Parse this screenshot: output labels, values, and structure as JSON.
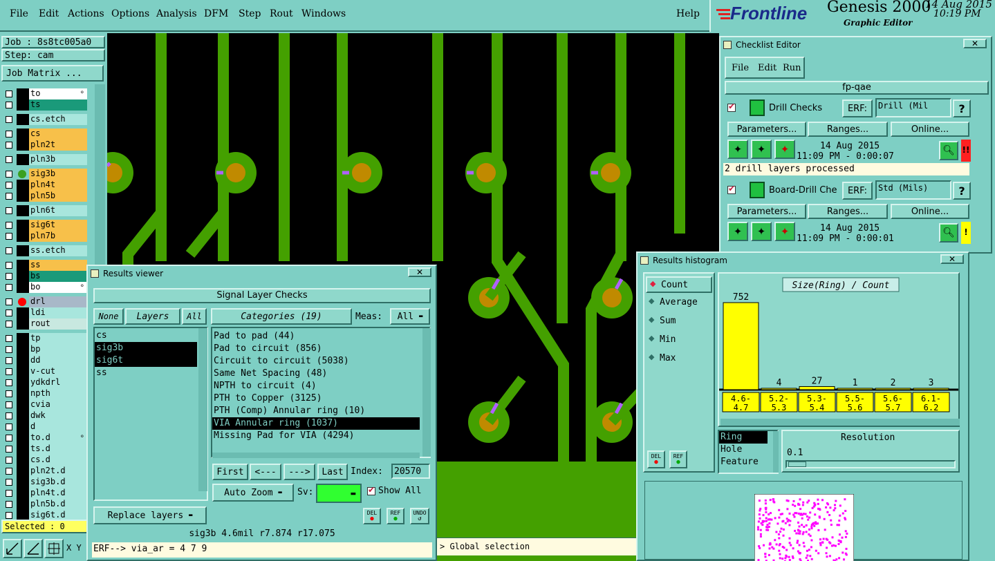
{
  "menubar": {
    "items": [
      "File",
      "Edit",
      "Actions",
      "Options",
      "Analysis",
      "DFM",
      "Step",
      "Rout",
      "Windows"
    ],
    "help": "Help"
  },
  "brand": {
    "logo": "Frontline",
    "product": "Genesis 2000",
    "subtitle": "Graphic Editor",
    "date": "14 Aug 2015",
    "time": "10:19 PM"
  },
  "left": {
    "job": "Job : 8s8tc005a0",
    "step": "Step: cam",
    "job_matrix": "Job Matrix ...",
    "selected": "Selected : 0",
    "layers": [
      {
        "name": "to",
        "color": "#ffffff",
        "flag": true
      },
      {
        "name": "ts",
        "color": "#1a9a7a"
      },
      {
        "name": "cs.etch",
        "color": "#a8e6dd"
      },
      {
        "name": "cs",
        "color": "#f7c04a"
      },
      {
        "name": "pln2t",
        "color": "#f7c04a"
      },
      {
        "name": "pln3b",
        "color": "#a8e6dd"
      },
      {
        "name": "sig3b",
        "color": "#f7c04a",
        "dot": "#3aa020"
      },
      {
        "name": "pln4t",
        "color": "#f7c04a"
      },
      {
        "name": "pln5b",
        "color": "#f7c04a"
      },
      {
        "name": "pln6t",
        "color": "#a8e6dd"
      },
      {
        "name": "sig6t",
        "color": "#f7c04a"
      },
      {
        "name": "pln7b",
        "color": "#f7c04a"
      },
      {
        "name": "ss.etch",
        "color": "#a8e6dd"
      },
      {
        "name": "ss",
        "color": "#f7c04a"
      },
      {
        "name": "bs",
        "color": "#1a9a7a"
      },
      {
        "name": "bo",
        "color": "#ffffff",
        "flag": true
      },
      {
        "name": "drl",
        "color": "#a8b8c8",
        "dot": "#ff0000"
      },
      {
        "name": "ldi",
        "color": "#a8e6dd"
      },
      {
        "name": "rout",
        "color": "#c8e8e0"
      },
      {
        "name": "tp",
        "color": "#a8e6dd"
      },
      {
        "name": "bp",
        "color": "#a8e6dd"
      },
      {
        "name": "dd",
        "color": "#a8e6dd"
      },
      {
        "name": "v-cut",
        "color": "#a8e6dd"
      },
      {
        "name": "ydkdrl",
        "color": "#a8e6dd"
      },
      {
        "name": "npth",
        "color": "#a8e6dd"
      },
      {
        "name": "cvia",
        "color": "#a8e6dd"
      },
      {
        "name": "dwk",
        "color": "#a8e6dd"
      },
      {
        "name": "d",
        "color": "#a8e6dd"
      },
      {
        "name": "to.d",
        "color": "#a8e6dd",
        "flag": true
      },
      {
        "name": "ts.d",
        "color": "#a8e6dd"
      },
      {
        "name": "cs.d",
        "color": "#a8e6dd"
      },
      {
        "name": "pln2t.d",
        "color": "#a8e6dd"
      },
      {
        "name": "sig3b.d",
        "color": "#a8e6dd"
      },
      {
        "name": "pln4t.d",
        "color": "#a8e6dd"
      },
      {
        "name": "pln5b.d",
        "color": "#a8e6dd"
      },
      {
        "name": "sig6t.d",
        "color": "#a8e6dd"
      }
    ],
    "xy": "X Y"
  },
  "status_line": {
    "text": "> Global selection"
  },
  "checklist": {
    "title": "Checklist Editor",
    "menu": [
      "File",
      "Edit",
      "Run"
    ],
    "name": "fp-qae",
    "checks": [
      {
        "label": "Drill Checks",
        "erf": "ERF:",
        "erf_value": "Drill (Mil",
        "params": "Parameters...",
        "ranges": "Ranges...",
        "online": "Online...",
        "date": "14 Aug 2015",
        "time": "11:09 PM - 0:00:07",
        "status": "2 drill layers processed",
        "flag": "!!",
        "flag_color": "#ff2020"
      },
      {
        "label": "Board-Drill Che",
        "erf": "ERF:",
        "erf_value": "Std (Mils)",
        "params": "Parameters...",
        "ranges": "Ranges...",
        "online": "Online...",
        "date": "14 Aug 2015",
        "time": "11:09 PM - 0:00:01",
        "flag": "!",
        "flag_color": "#ffff00"
      }
    ],
    "help": "?"
  },
  "results_viewer": {
    "title": "Results viewer",
    "header": "Signal Layer Checks",
    "none": "None",
    "layers_label": "Layers",
    "all": "All",
    "layers": [
      "cs",
      "sig3b",
      "sig6t",
      "ss"
    ],
    "categories_label": "Categories (19)",
    "meas_label": "Meas:",
    "meas_value": "All",
    "categories": [
      "Pad to pad (44)",
      "Pad to circuit (856)",
      "Circuit to circuit (5038)",
      "Same Net Spacing (48)",
      "NPTH to circuit (4)",
      "PTH to Copper (3125)",
      "PTH (Comp) Annular ring (10)",
      "VIA Annular ring (1037)",
      "Missing Pad for VIA (4294)"
    ],
    "first": "First",
    "prev": "<---",
    "next": "--->",
    "last": "Last",
    "index_label": "Index:",
    "index_value": "20570",
    "auto_zoom": "Auto Zoom",
    "sv": "Sv:",
    "show_all": "Show All",
    "replace_layers": "Replace layers",
    "del": "DEL",
    "ref": "REF",
    "undo": "UNDO",
    "status": "sig3b 4.6mil  r7.874  r17.075",
    "erf": "ERF--> via_ar = 4 7 9"
  },
  "histogram": {
    "title": "Results histogram",
    "options": [
      "Count",
      "Average",
      "Sum",
      "Min",
      "Max"
    ],
    "selected": "Count",
    "del": "DEL",
    "ref": "REF",
    "resolution_label": "Resolution",
    "resolution_value": "0.1",
    "fields": [
      "Ring",
      "Hole",
      "Feature"
    ],
    "chart_title": "Size(Ring) / Count"
  },
  "chart_data": {
    "type": "bar",
    "title": "Size(Ring) / Count",
    "categories": [
      "4.6-4.7",
      "5.2-5.3",
      "5.3-5.4",
      "5.5-5.6",
      "5.6-5.7",
      "6.1-6.2"
    ],
    "category_lines": [
      [
        "4.6-",
        "4.7"
      ],
      [
        "5.2-",
        "5.3"
      ],
      [
        "5.3-",
        "5.4"
      ],
      [
        "5.5-",
        "5.6"
      ],
      [
        "5.6-",
        "5.7"
      ],
      [
        "6.1-",
        "6.2"
      ]
    ],
    "values": [
      752,
      4,
      27,
      1,
      2,
      3
    ],
    "bar_color": "#ffff00"
  }
}
